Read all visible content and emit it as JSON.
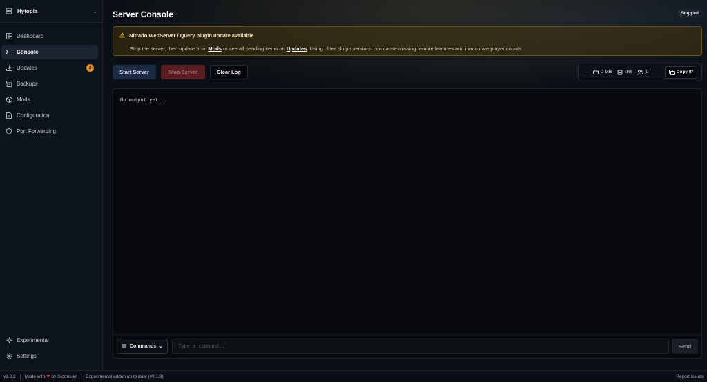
{
  "app": {
    "name": "Hytopia"
  },
  "sidebar": {
    "items": [
      {
        "label": "Dashboard",
        "icon": "dashboard-icon",
        "active": false
      },
      {
        "label": "Console",
        "icon": "terminal-icon",
        "active": true
      },
      {
        "label": "Updates",
        "icon": "download-icon",
        "active": false,
        "badge": "2"
      },
      {
        "label": "Backups",
        "icon": "archive-icon",
        "active": false
      },
      {
        "label": "Mods",
        "icon": "package-icon",
        "active": false
      },
      {
        "label": "Configuration",
        "icon": "file-icon",
        "active": false
      },
      {
        "label": "Port Forwarding",
        "icon": "shield-icon",
        "active": false
      }
    ],
    "bottom_items": [
      {
        "label": "Experimental",
        "icon": "sparkles-icon"
      },
      {
        "label": "Settings",
        "icon": "gear-icon"
      }
    ]
  },
  "header": {
    "title": "Server Console",
    "status": "Stopped"
  },
  "alert": {
    "title": "Nitrado WebServer / Query plugin update available",
    "text_before": "Stop the server, then update from ",
    "link_mods": "Mods",
    "text_mid": " or see all pending items on ",
    "link_updates": "Updates",
    "text_after": ". Using older plugin versions can cause missing remote features and inaccurate player counts."
  },
  "actions": {
    "start": "Start Server",
    "stop": "Stop Server",
    "clear": "Clear Log"
  },
  "stats": {
    "uptime": "—",
    "memory": "0 MB",
    "cpu": "0%",
    "players": "0",
    "copy_ip": "Copy IP"
  },
  "console": {
    "output": "No output yet...",
    "commands_label": "Commands",
    "input_placeholder": "Type a command...",
    "send_label": "Send"
  },
  "footer": {
    "version": "v3.0.2",
    "made_with": "Made with",
    "by": "by Stormster",
    "addon_status": "Experimental addon up to date (v0.1.3)",
    "report": "Report issues"
  },
  "colors": {
    "accent_warning": "#f2c037",
    "badge": "#d9901e",
    "stop_button": "#5a1d22",
    "start_button": "#1c2a45"
  }
}
